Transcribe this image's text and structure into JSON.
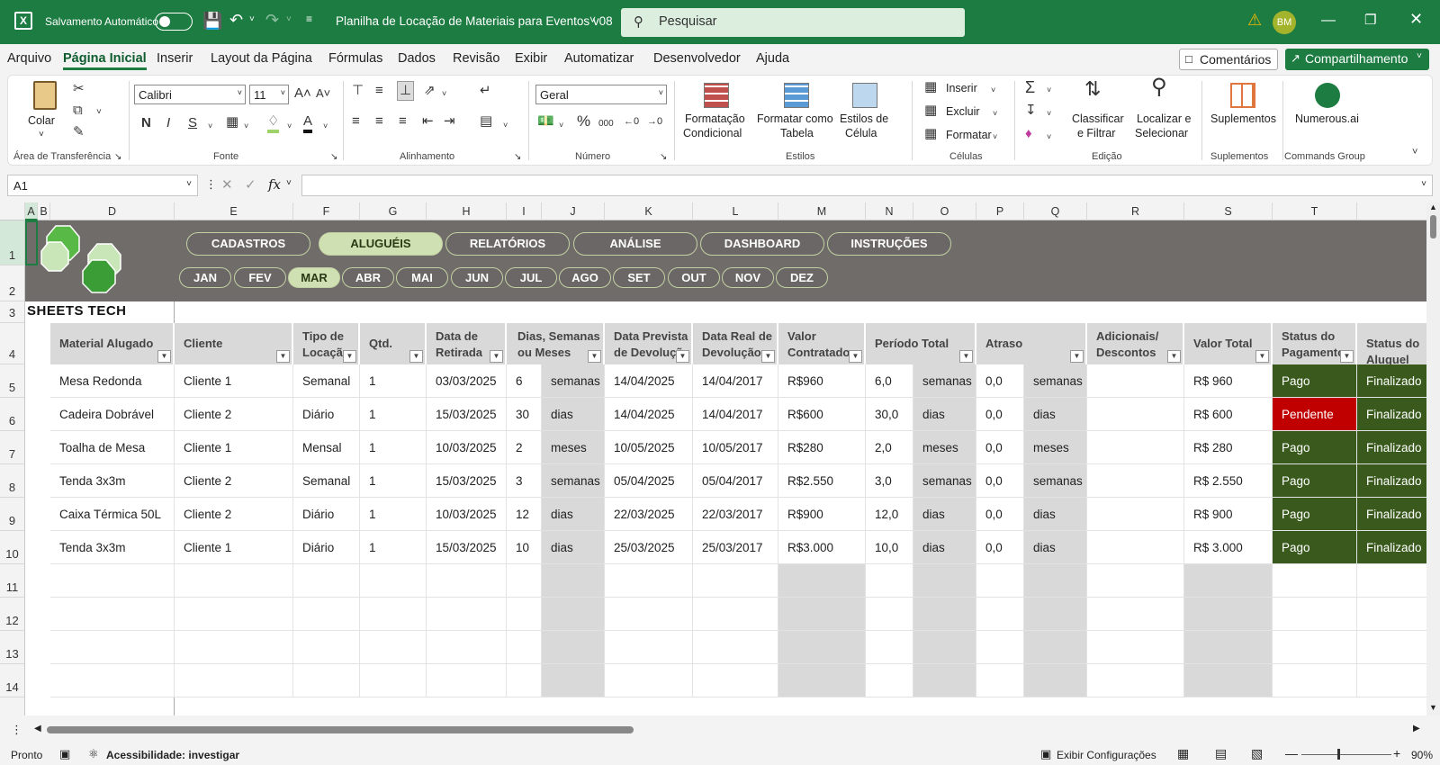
{
  "titlebar": {
    "autosave_label": "Salvamento Automático",
    "doc_title": "Planilha de Locação de Materiais para Eventos v08",
    "search_placeholder": "Pesquisar",
    "avatar": "BM"
  },
  "menu": {
    "items": [
      "Arquivo",
      "Página Inicial",
      "Inserir",
      "Layout da Página",
      "Fórmulas",
      "Dados",
      "Revisão",
      "Exibir",
      "Automatizar",
      "Desenvolvedor",
      "Ajuda"
    ],
    "active": "Página Inicial",
    "comments": "Comentários",
    "share": "Compartilhamento"
  },
  "ribbon": {
    "paste": "Colar",
    "clipboard_group": "Área de Transferência",
    "font_name": "Calibri",
    "font_size": "11",
    "font_group": "Fonte",
    "align_group": "Alinhamento",
    "number_format": "Geral",
    "number_group": "Número",
    "cond_format": [
      "Formatação",
      "Condicional"
    ],
    "format_table": [
      "Formatar como",
      "Tabela"
    ],
    "cell_styles": [
      "Estilos de",
      "Célula"
    ],
    "styles_group": "Estilos",
    "insert": "Inserir",
    "delete": "Excluir",
    "format": "Formatar",
    "cells_group": "Células",
    "sort_filter": [
      "Classificar",
      "e Filtrar"
    ],
    "find_select": [
      "Localizar e",
      "Selecionar"
    ],
    "edit_group": "Edição",
    "addins": "Suplementos",
    "addins_group": "Suplementos",
    "numerous": "Numerous.ai",
    "commands_group": "Commands Group"
  },
  "formula_bar": {
    "cell_ref": "A1",
    "fx": "fx",
    "content": ""
  },
  "columns": [
    "A",
    "B",
    "D",
    "E",
    "F",
    "G",
    "H",
    "I",
    "J",
    "K",
    "L",
    "M",
    "N",
    "O",
    "P",
    "Q",
    "R",
    "S",
    "T"
  ],
  "rows": [
    "1",
    "2",
    "3",
    "4",
    "5",
    "6",
    "7",
    "8",
    "9",
    "10",
    "11",
    "12",
    "13",
    "14"
  ],
  "brand": "SHEETS TECH",
  "nav_tabs": [
    "CADASTROS",
    "ALUGUÉIS",
    "RELATÓRIOS",
    "ANÁLISE",
    "DASHBOARD",
    "INSTRUÇÕES"
  ],
  "nav_active": "ALUGUÉIS",
  "months": [
    "JAN",
    "FEV",
    "MAR",
    "ABR",
    "MAI",
    "JUN",
    "JUL",
    "AGO",
    "SET",
    "OUT",
    "NOV",
    "DEZ"
  ],
  "month_active": "MAR",
  "table_headers": [
    "Material Alugado",
    "Cliente",
    "Tipo de Locação",
    "Qtd.",
    "Data de Retirada",
    "Dias, Semanas ou Meses",
    "Data Prevista de Devolução",
    "Data Real de Devolução",
    "Valor Contratado",
    "Período Total",
    "Atraso",
    "Adicionais/ Descontos",
    "Valor Total",
    "Status do Pagamento",
    "Status do Aluguel"
  ],
  "table_rows": [
    [
      "Mesa Redonda",
      "Cliente 1",
      "Semanal",
      "1",
      "03/03/2025",
      "6",
      "semanas",
      "14/04/2025",
      "14/04/2017",
      "R$960",
      "6,0",
      "semanas",
      "0,0",
      "semanas",
      "",
      "R$ 960",
      "Pago",
      "Finalizado"
    ],
    [
      "Cadeira Dobrável",
      "Cliente 2",
      "Diário",
      "1",
      "15/03/2025",
      "30",
      "dias",
      "14/04/2025",
      "14/04/2017",
      "R$600",
      "30,0",
      "dias",
      "0,0",
      "dias",
      "",
      "R$ 600",
      "Pendente",
      "Finalizado"
    ],
    [
      "Toalha de Mesa",
      "Cliente 1",
      "Mensal",
      "1",
      "10/03/2025",
      "2",
      "meses",
      "10/05/2025",
      "10/05/2017",
      "R$280",
      "2,0",
      "meses",
      "0,0",
      "meses",
      "",
      "R$ 280",
      "Pago",
      "Finalizado"
    ],
    [
      "Tenda 3x3m",
      "Cliente 2",
      "Semanal",
      "1",
      "15/03/2025",
      "3",
      "semanas",
      "05/04/2025",
      "05/04/2017",
      "R$2.550",
      "3,0",
      "semanas",
      "0,0",
      "semanas",
      "",
      "R$ 2.550",
      "Pago",
      "Finalizado"
    ],
    [
      "Caixa Térmica 50L",
      "Cliente 2",
      "Diário",
      "1",
      "10/03/2025",
      "12",
      "dias",
      "22/03/2025",
      "22/03/2017",
      "R$900",
      "12,0",
      "dias",
      "0,0",
      "dias",
      "",
      "R$ 900",
      "Pago",
      "Finalizado"
    ],
    [
      "Tenda 3x3m",
      "Cliente 1",
      "Diário",
      "1",
      "15/03/2025",
      "10",
      "dias",
      "25/03/2025",
      "25/03/2017",
      "R$3.000",
      "10,0",
      "dias",
      "0,0",
      "dias",
      "",
      "R$ 3.000",
      "Pago",
      "Finalizado"
    ]
  ],
  "statusbar": {
    "ready": "Pronto",
    "accessibility": "Acessibilidade: investigar",
    "display_settings": "Exibir Configurações",
    "zoom": "90%"
  },
  "colors": {
    "excel_green": "#1c7c42",
    "paid": "#395a1c",
    "pending": "#c00000",
    "header_grey": "#d9d9d9",
    "band": "#706c69"
  }
}
